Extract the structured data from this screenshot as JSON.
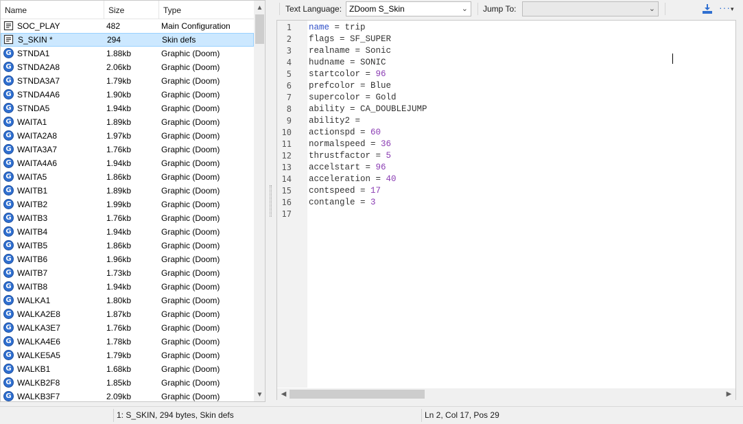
{
  "list": {
    "columns": {
      "name": "Name",
      "size": "Size",
      "type": "Type"
    },
    "rows": [
      {
        "icon": "text-file-icon",
        "name": "SOC_PLAY",
        "size": "482",
        "type": "Main Configuration",
        "selected": false
      },
      {
        "icon": "text-file-icon",
        "name": "S_SKIN *",
        "size": "294",
        "type": "Skin defs",
        "selected": true
      },
      {
        "icon": "graphic-icon",
        "name": "STNDA1",
        "size": "1.88kb",
        "type": "Graphic (Doom)",
        "selected": false
      },
      {
        "icon": "graphic-icon",
        "name": "STNDA2A8",
        "size": "2.06kb",
        "type": "Graphic (Doom)",
        "selected": false
      },
      {
        "icon": "graphic-icon",
        "name": "STNDA3A7",
        "size": "1.79kb",
        "type": "Graphic (Doom)",
        "selected": false
      },
      {
        "icon": "graphic-icon",
        "name": "STNDA4A6",
        "size": "1.90kb",
        "type": "Graphic (Doom)",
        "selected": false
      },
      {
        "icon": "graphic-icon",
        "name": "STNDA5",
        "size": "1.94kb",
        "type": "Graphic (Doom)",
        "selected": false
      },
      {
        "icon": "graphic-icon",
        "name": "WAITA1",
        "size": "1.89kb",
        "type": "Graphic (Doom)",
        "selected": false
      },
      {
        "icon": "graphic-icon",
        "name": "WAITA2A8",
        "size": "1.97kb",
        "type": "Graphic (Doom)",
        "selected": false
      },
      {
        "icon": "graphic-icon",
        "name": "WAITA3A7",
        "size": "1.76kb",
        "type": "Graphic (Doom)",
        "selected": false
      },
      {
        "icon": "graphic-icon",
        "name": "WAITA4A6",
        "size": "1.94kb",
        "type": "Graphic (Doom)",
        "selected": false
      },
      {
        "icon": "graphic-icon",
        "name": "WAITA5",
        "size": "1.86kb",
        "type": "Graphic (Doom)",
        "selected": false
      },
      {
        "icon": "graphic-icon",
        "name": "WAITB1",
        "size": "1.89kb",
        "type": "Graphic (Doom)",
        "selected": false
      },
      {
        "icon": "graphic-icon",
        "name": "WAITB2",
        "size": "1.99kb",
        "type": "Graphic (Doom)",
        "selected": false
      },
      {
        "icon": "graphic-icon",
        "name": "WAITB3",
        "size": "1.76kb",
        "type": "Graphic (Doom)",
        "selected": false
      },
      {
        "icon": "graphic-icon",
        "name": "WAITB4",
        "size": "1.94kb",
        "type": "Graphic (Doom)",
        "selected": false
      },
      {
        "icon": "graphic-icon",
        "name": "WAITB5",
        "size": "1.86kb",
        "type": "Graphic (Doom)",
        "selected": false
      },
      {
        "icon": "graphic-icon",
        "name": "WAITB6",
        "size": "1.96kb",
        "type": "Graphic (Doom)",
        "selected": false
      },
      {
        "icon": "graphic-icon",
        "name": "WAITB7",
        "size": "1.73kb",
        "type": "Graphic (Doom)",
        "selected": false
      },
      {
        "icon": "graphic-icon",
        "name": "WAITB8",
        "size": "1.94kb",
        "type": "Graphic (Doom)",
        "selected": false
      },
      {
        "icon": "graphic-icon",
        "name": "WALKA1",
        "size": "1.80kb",
        "type": "Graphic (Doom)",
        "selected": false
      },
      {
        "icon": "graphic-icon",
        "name": "WALKA2E8",
        "size": "1.87kb",
        "type": "Graphic (Doom)",
        "selected": false
      },
      {
        "icon": "graphic-icon",
        "name": "WALKA3E7",
        "size": "1.76kb",
        "type": "Graphic (Doom)",
        "selected": false
      },
      {
        "icon": "graphic-icon",
        "name": "WALKA4E6",
        "size": "1.78kb",
        "type": "Graphic (Doom)",
        "selected": false
      },
      {
        "icon": "graphic-icon",
        "name": "WALKE5A5",
        "size": "1.79kb",
        "type": "Graphic (Doom)",
        "selected": false
      },
      {
        "icon": "graphic-icon",
        "name": "WALKB1",
        "size": "1.68kb",
        "type": "Graphic (Doom)",
        "selected": false
      },
      {
        "icon": "graphic-icon",
        "name": "WALKB2F8",
        "size": "1.85kb",
        "type": "Graphic (Doom)",
        "selected": false
      },
      {
        "icon": "graphic-icon",
        "name": "WALKB3F7",
        "size": "2.09kb",
        "type": "Graphic (Doom)",
        "selected": false
      }
    ]
  },
  "toolbar": {
    "text_language_label": "Text Language:",
    "text_language_value": "ZDoom S_Skin",
    "jump_to_label": "Jump To:",
    "jump_to_value": "",
    "more_label": "···"
  },
  "editor": {
    "lines": [
      {
        "n": "1",
        "key": "name",
        "key_keyword": true,
        "op": " = ",
        "value": "trip",
        "value_number": false
      },
      {
        "n": "2",
        "key": "flags",
        "key_keyword": false,
        "op": " = ",
        "value": "SF_SUPER",
        "value_number": false
      },
      {
        "n": "3",
        "key": "realname",
        "key_keyword": false,
        "op": " = ",
        "value": "Sonic",
        "value_number": false
      },
      {
        "n": "4",
        "key": "hudname",
        "key_keyword": false,
        "op": " = ",
        "value": "SONIC",
        "value_number": false
      },
      {
        "n": "5",
        "key": "startcolor",
        "key_keyword": false,
        "op": " = ",
        "value": "96",
        "value_number": true
      },
      {
        "n": "6",
        "key": "prefcolor",
        "key_keyword": false,
        "op": " = ",
        "value": "Blue",
        "value_number": false
      },
      {
        "n": "7",
        "key": "supercolor",
        "key_keyword": false,
        "op": " = ",
        "value": "Gold",
        "value_number": false
      },
      {
        "n": "8",
        "key": "ability",
        "key_keyword": false,
        "op": " = ",
        "value": "CA_DOUBLEJUMP",
        "value_number": false
      },
      {
        "n": "9",
        "key": "ability2",
        "key_keyword": false,
        "op": " = ",
        "value": "",
        "value_number": false
      },
      {
        "n": "10",
        "key": "actionspd",
        "key_keyword": false,
        "op": " = ",
        "value": "60",
        "value_number": true
      },
      {
        "n": "11",
        "key": "normalspeed",
        "key_keyword": false,
        "op": " = ",
        "value": "36",
        "value_number": true
      },
      {
        "n": "12",
        "key": "thrustfactor",
        "key_keyword": false,
        "op": " = ",
        "value": "5",
        "value_number": true
      },
      {
        "n": "13",
        "key": "accelstart",
        "key_keyword": false,
        "op": " = ",
        "value": "96",
        "value_number": true
      },
      {
        "n": "14",
        "key": "acceleration",
        "key_keyword": false,
        "op": " = ",
        "value": "40",
        "value_number": true
      },
      {
        "n": "15",
        "key": "contspeed",
        "key_keyword": false,
        "op": " = ",
        "value": "17",
        "value_number": true
      },
      {
        "n": "16",
        "key": "contangle",
        "key_keyword": false,
        "op": " = ",
        "value": "3",
        "value_number": true
      },
      {
        "n": "17",
        "key": "",
        "key_keyword": false,
        "op": "",
        "value": "",
        "value_number": false
      }
    ]
  },
  "statusbar": {
    "entry_info": "1: S_SKIN, 294 bytes, Skin defs",
    "cursor_info": "Ln 2, Col 17, Pos 29"
  },
  "colors": {
    "selection_bg": "#cce8ff",
    "keyword": "#3050c8",
    "number": "#8a3cb3",
    "graphic_icon": "#2f6fd0"
  }
}
